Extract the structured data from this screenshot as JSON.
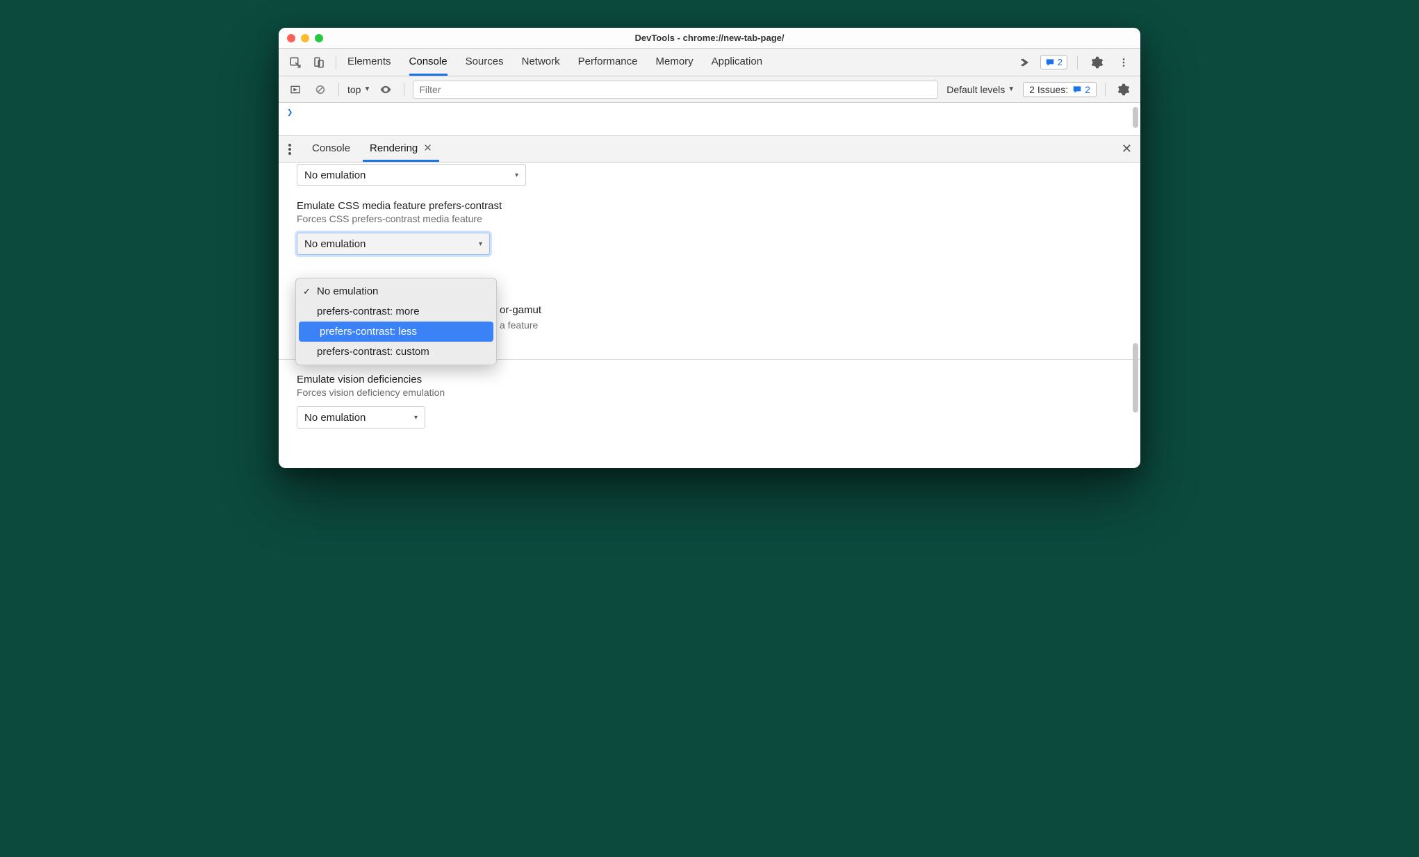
{
  "window": {
    "title": "DevTools - chrome://new-tab-page/"
  },
  "main_tabs": {
    "elements": "Elements",
    "console": "Console",
    "sources": "Sources",
    "network": "Network",
    "performance": "Performance",
    "memory": "Memory",
    "application": "Application",
    "badge_count": "2"
  },
  "console_toolbar": {
    "context": "top",
    "filter_placeholder": "Filter",
    "levels": "Default levels",
    "issues_label": "2 Issues:",
    "issues_count": "2"
  },
  "console_prompt": "❯",
  "drawer": {
    "tab_console": "Console",
    "tab_rendering": "Rendering"
  },
  "rendering": {
    "top_select_value": "No emulation",
    "contrast_title": "Emulate CSS media feature prefers-contrast",
    "contrast_desc": "Forces CSS prefers-contrast media feature",
    "contrast_select_value": "No emulation",
    "gamut_title_tail": "or-gamut",
    "gamut_desc_tail": "a feature",
    "vision_title": "Emulate vision deficiencies",
    "vision_desc": "Forces vision deficiency emulation",
    "vision_select_value": "No emulation"
  },
  "dropdown": {
    "options": [
      "No emulation",
      "prefers-contrast: more",
      "prefers-contrast: less",
      "prefers-contrast: custom"
    ],
    "checked_index": 0,
    "highlight_index": 2
  }
}
